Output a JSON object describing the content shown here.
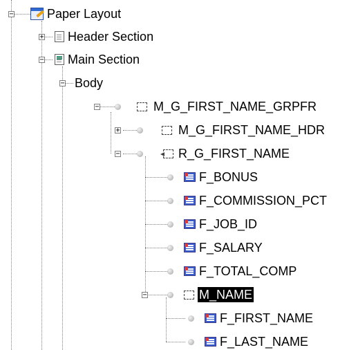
{
  "tree": {
    "root": {
      "label": "Paper Layout",
      "icon": "paper-layout-icon",
      "expander": "−"
    },
    "header_section": {
      "label": "Header Section",
      "icon": "document-icon",
      "expander": "+"
    },
    "main_section": {
      "label": "Main Section",
      "icon": "main-document-icon",
      "expander": "−"
    },
    "body": {
      "label": "Body",
      "expander": "−"
    },
    "m_grpfr": {
      "label": "M_G_FIRST_NAME_GRPFR",
      "icon": "frame-icon",
      "expander": "−"
    },
    "m_hdr": {
      "label": "M_G_FIRST_NAME_HDR",
      "icon": "frame-icon",
      "expander": "+"
    },
    "r_first": {
      "label": "R_G_FIRST_NAME",
      "icon": "repeating-frame-icon",
      "expander": "−"
    },
    "fields": [
      {
        "label": "F_BONUS",
        "icon": "field-icon"
      },
      {
        "label": "F_COMMISSION_PCT",
        "icon": "field-icon"
      },
      {
        "label": "F_JOB_ID",
        "icon": "field-icon"
      },
      {
        "label": "F_SALARY",
        "icon": "field-icon"
      },
      {
        "label": "F_TOTAL_COMP",
        "icon": "field-icon"
      }
    ],
    "m_name": {
      "label": "M_NAME",
      "icon": "frame-icon",
      "expander": "−",
      "selected": true
    },
    "name_fields": [
      {
        "label": "F_FIRST_NAME",
        "icon": "field-icon"
      },
      {
        "label": "F_LAST_NAME",
        "icon": "field-icon"
      }
    ]
  },
  "colors": {
    "selection": "#000000",
    "connector": "#808080",
    "field_icon": "#3a5fcd"
  }
}
